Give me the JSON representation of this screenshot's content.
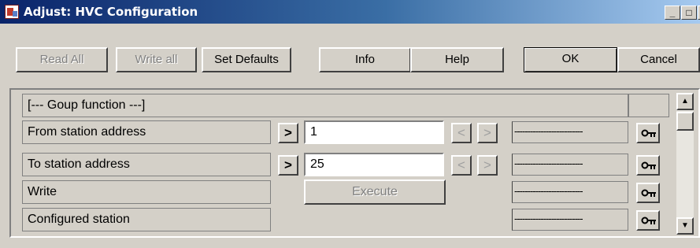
{
  "window": {
    "title": "Adjust: HVC Configuration",
    "controls": {
      "minimize": "_",
      "maximize": "□",
      "close": "×"
    }
  },
  "toolbar": {
    "read_all": "Read All",
    "write_all": "Write all",
    "set_defaults": "Set Defaults",
    "info": "Info",
    "help": "Help",
    "ok": "OK",
    "cancel": "Cancel"
  },
  "grid": {
    "group_header": "[--- Goup function ---]",
    "rows": [
      {
        "label": "From station address",
        "value": "1",
        "status": "--------------------------"
      },
      {
        "label": "To station address",
        "value": "25",
        "status": "--------------------------"
      },
      {
        "label": "Write",
        "action": "Execute",
        "status": "--------------------------"
      },
      {
        "label": "Configured station",
        "status": "--------------------------"
      }
    ],
    "arrow_right": ">",
    "arrow_left": "<"
  },
  "icons": {
    "app": "app-icon",
    "key": "key-icon",
    "scroll_up": "▲",
    "scroll_down": "▼"
  }
}
